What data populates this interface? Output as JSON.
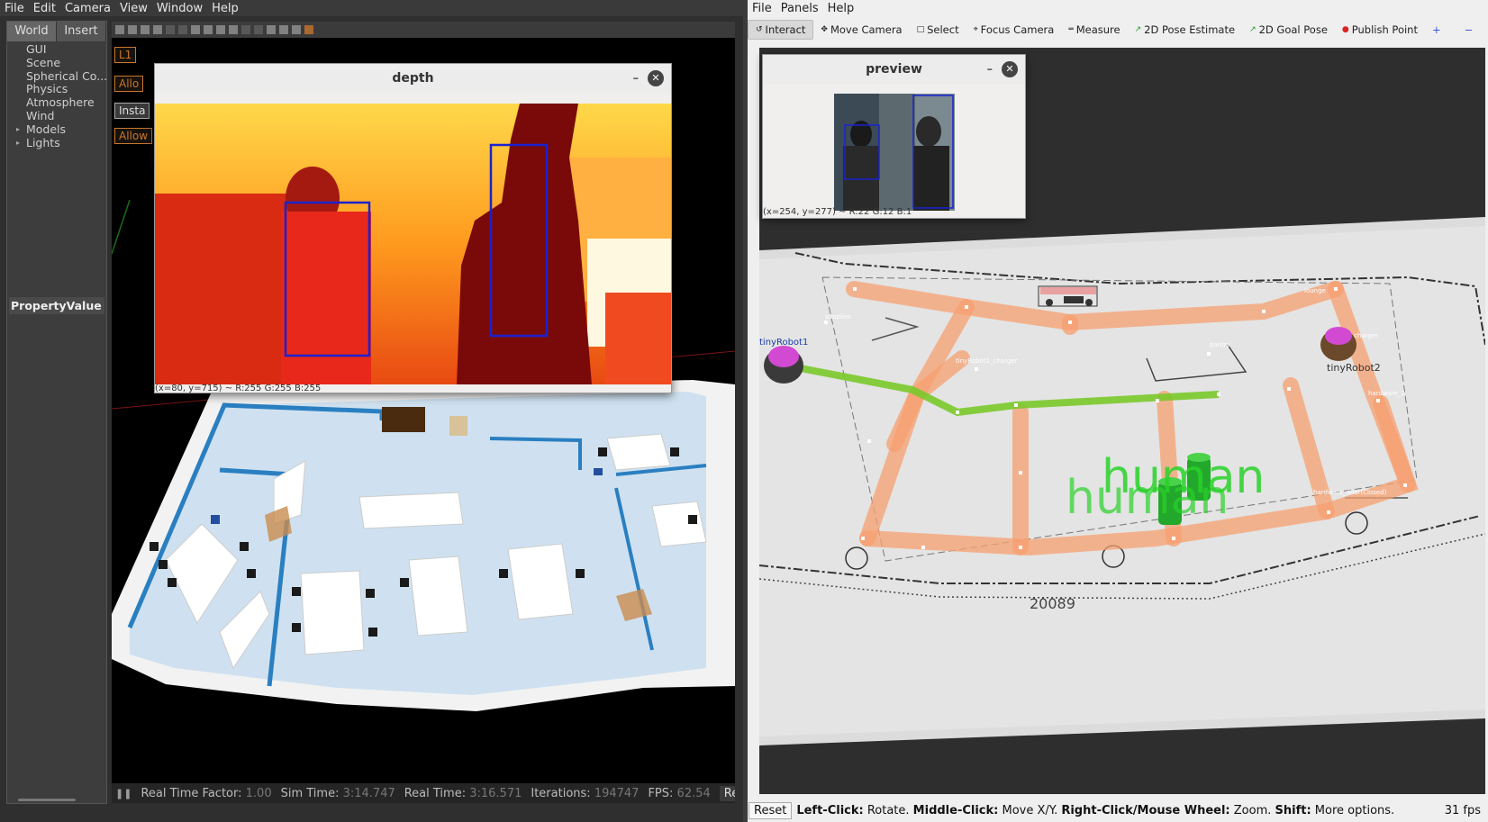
{
  "gazebo": {
    "menu": [
      "File",
      "Edit",
      "Camera",
      "View",
      "Window",
      "Help"
    ],
    "tabs": [
      "World",
      "Insert"
    ],
    "tree": [
      {
        "label": "GUI",
        "arrow": false
      },
      {
        "label": "Scene",
        "arrow": false
      },
      {
        "label": "Spherical Co...",
        "arrow": false
      },
      {
        "label": "Physics",
        "arrow": false
      },
      {
        "label": "Atmosphere",
        "arrow": false
      },
      {
        "label": "Wind",
        "arrow": false
      },
      {
        "label": "Models",
        "arrow": true
      },
      {
        "label": "Lights",
        "arrow": true
      }
    ],
    "property_header": "PropertyValue",
    "overlay": {
      "l1": "L1",
      "allow1": "Allo",
      "insta": "Insta",
      "allow2": "Allow"
    },
    "status": {
      "rtf_label": "Real Time Factor:",
      "rtf_value": "1.00",
      "sim_label": "Sim Time:",
      "sim_value": "3:14.747",
      "real_label": "Real Time:",
      "real_value": "3:16.571",
      "iter_label": "Iterations:",
      "iter_value": "194747",
      "fps_label": "FPS:",
      "fps_value": "62.54",
      "reset_label": "Reset Time"
    }
  },
  "depth_window": {
    "title": "depth",
    "min": "–",
    "close": "✕",
    "readout": "(x=80, y=715) ~ R:255 G:255 B:255"
  },
  "rviz": {
    "menu": [
      "File",
      "Panels",
      "Help"
    ],
    "tools": [
      {
        "label": "Interact",
        "icon": "↺",
        "active": true
      },
      {
        "label": "Move Camera",
        "icon": "✥",
        "active": false
      },
      {
        "label": "Select",
        "icon": "□",
        "active": false
      },
      {
        "label": "Focus Camera",
        "icon": "⌖",
        "active": false
      },
      {
        "label": "Measure",
        "icon": "═",
        "active": false
      },
      {
        "label": "2D Pose Estimate",
        "icon": "↗",
        "active": false
      },
      {
        "label": "2D Goal Pose",
        "icon": "↗",
        "active": false
      },
      {
        "label": "Publish Point",
        "icon": "📍",
        "active": false
      }
    ],
    "plus_icon": "+",
    "minus_icon": "−",
    "preview": {
      "title": "preview",
      "min": "–",
      "close": "✕",
      "readout": "(x=254, y=277) ~ R:22 G:12 B:1"
    },
    "map_labels": {
      "robot1": "tinyRobot1",
      "robot2": "tinyRobot2",
      "supplies": "supplies",
      "lounge": "lounge",
      "pantry": "pantry",
      "charger1": "tinyRobot1_charger",
      "charger2": "charger",
      "hardware": "hardware_2",
      "door": "hardware_door(Closed)",
      "human_a": "human",
      "human_b": "human",
      "room": "20089"
    },
    "bottom": {
      "reset": "Reset",
      "left_key": "Left-Click:",
      "left_val": " Rotate. ",
      "mid_key": "Middle-Click:",
      "mid_val": " Move X/Y. ",
      "right_key": "Right-Click/Mouse Wheel:",
      "right_val": " Zoom. ",
      "shift_key": "Shift:",
      "shift_val": " More options.",
      "fps": "31 fps"
    }
  }
}
